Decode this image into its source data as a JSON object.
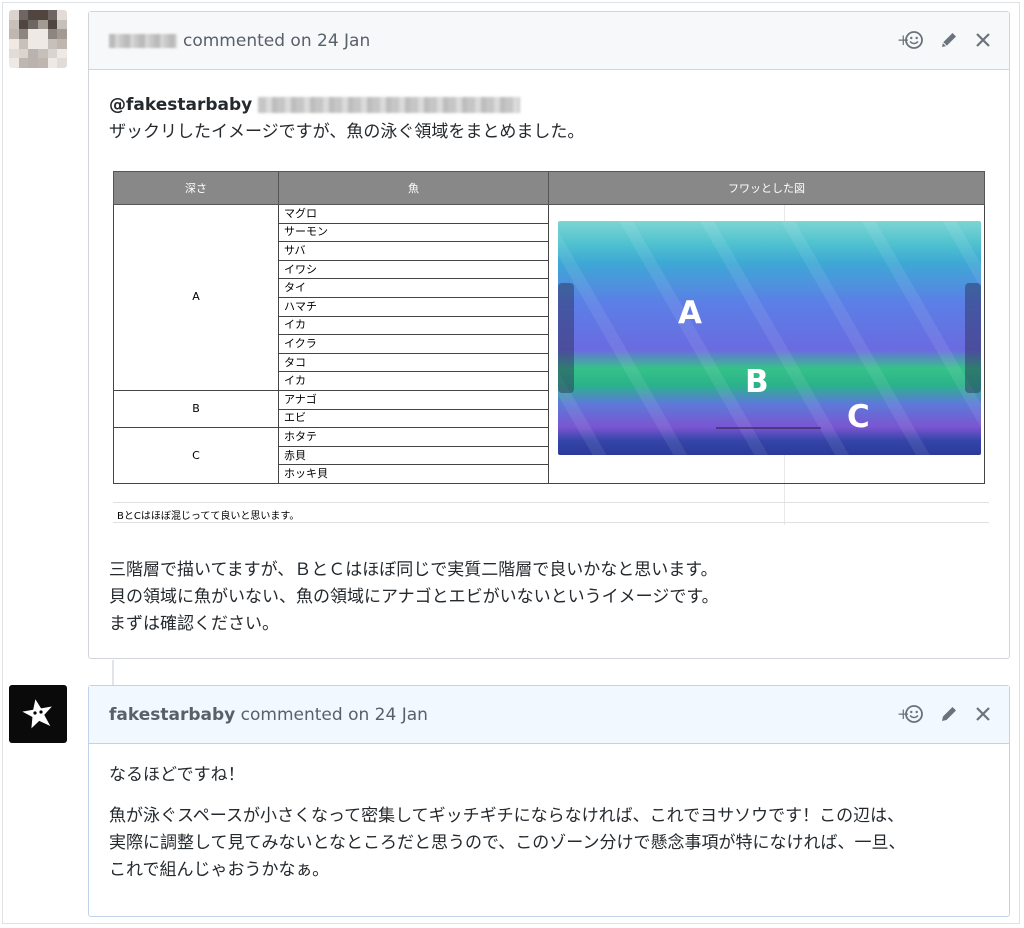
{
  "comment1": {
    "author": "(redacted)",
    "action": "commented on 24 Jan",
    "mention": "@fakestarbaby",
    "intro": "ザックリしたイメージですが、魚の泳ぐ領域をまとめました。",
    "table": {
      "headers": [
        "深さ",
        "魚",
        "フワッとした図"
      ],
      "groups": [
        {
          "label": "A",
          "fish": [
            "マグロ",
            "サーモン",
            "サバ",
            "イワシ",
            "タイ",
            "ハマチ",
            "イカ",
            "イクラ",
            "タコ",
            "イカ"
          ]
        },
        {
          "label": "B",
          "fish": [
            "アナゴ",
            "エビ"
          ]
        },
        {
          "label": "C",
          "fish": [
            "ホタテ",
            "赤貝",
            "ホッキ貝"
          ]
        }
      ],
      "note": "BとCはほぼ混じってて良いと思います。"
    },
    "figure": {
      "zone_a": "A",
      "zone_b": "B",
      "zone_c": "C"
    },
    "para1": "三階層で描いてますが、ＢとＣはほぼ同じで実質二階層で良いかなと思います。",
    "para2": "貝の領域に魚がいない、魚の領域にアナゴとエビがいないというイメージです。",
    "para3": "まずは確認ください。"
  },
  "comment2": {
    "author": "fakestarbaby",
    "action": "commented on 24 Jan",
    "p1": "なるほどですね！",
    "p2_l1": "魚が泳ぐスペースが小さくなって密集してギッチギチにならなければ、これでヨサソウです！この辺は、",
    "p2_l2": "実際に調整して見てみないとなところだと思うので、このゾーン分けで懸念事項が特になければ、一旦、",
    "p2_l3": "これで組んじゃおうかなぁ。"
  },
  "icons": {
    "reaction": "add-reaction-icon",
    "edit": "pencil-icon",
    "close": "close-icon"
  },
  "colors": {
    "header_bg": "#f6f8fa",
    "header2_bg": "#f1f8ff",
    "table_header": "#888888"
  }
}
